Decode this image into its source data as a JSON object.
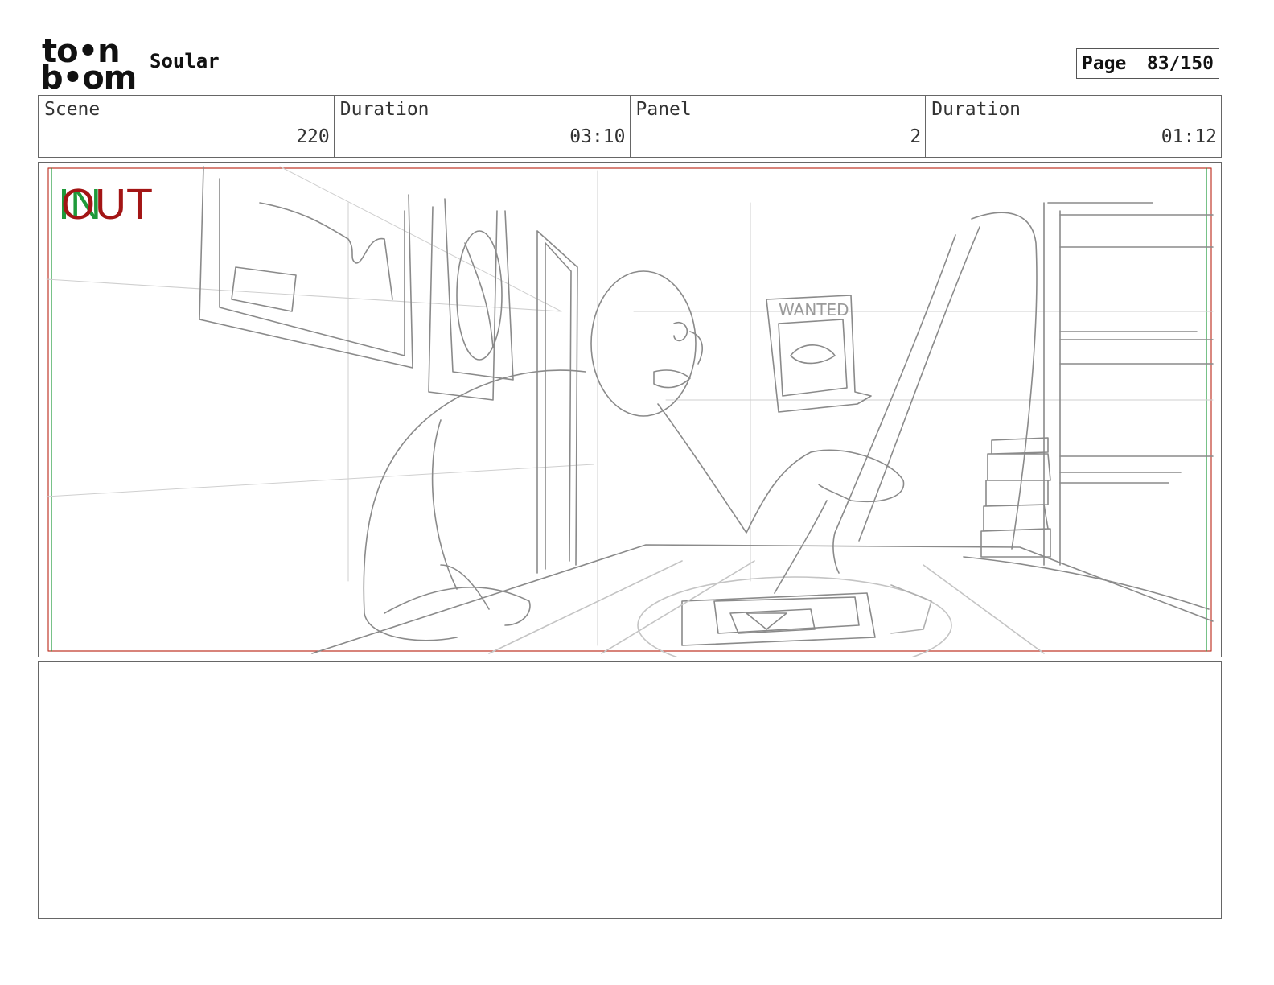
{
  "header": {
    "logo_line1": "to•n",
    "logo_line2": "b•om",
    "project_title": "Soular",
    "page_label": "Page",
    "page_value": "83/150"
  },
  "info": {
    "scene_label": "Scene",
    "scene_value": "220",
    "scene_duration_label": "Duration",
    "scene_duration_value": "03:10",
    "panel_label": "Panel",
    "panel_value": "2",
    "panel_duration_label": "Duration",
    "panel_duration_value": "01:12"
  },
  "panel": {
    "in_mark": "IN",
    "out_mark": "OUT",
    "poster_text": "WANTED",
    "in_color": "#1f9a3a",
    "out_color": "#a31515"
  },
  "notes": {
    "text": ""
  }
}
